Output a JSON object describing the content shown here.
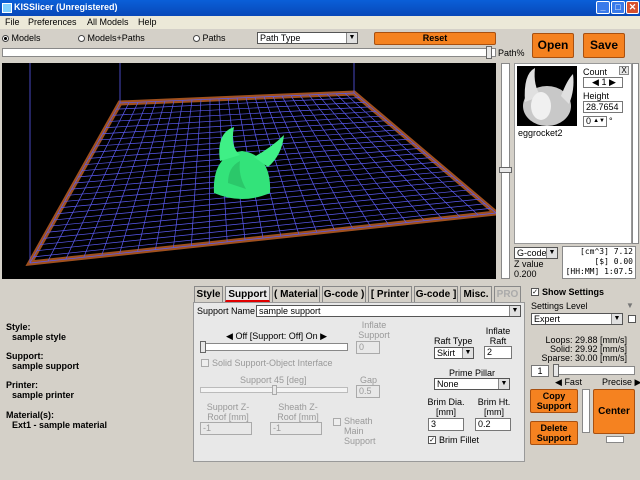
{
  "window": {
    "title": "KISSlicer (Unregistered)"
  },
  "menu": [
    "File",
    "Preferences",
    "All Models",
    "Help"
  ],
  "view_modes": {
    "models": "Models",
    "models_paths": "Models+Paths",
    "paths": "Paths",
    "path_type": "Path Type",
    "reset": "Reset",
    "path_percent": "Path%"
  },
  "actions": {
    "open": "Open",
    "save": "Save"
  },
  "model_panel": {
    "name": "eggrocket2",
    "count_label": "Count",
    "count": "1",
    "height_label": "Height",
    "height": "28.7654",
    "rotation": "0",
    "degree_symbol": "°",
    "close": "X"
  },
  "gcode": {
    "select": "G-code",
    "volume": "[cm^3] 7.12",
    "cost": "[$] 0.00",
    "time": "[HH:MM] 1:07.5",
    "z_label": "Z value",
    "z_value": "0.200"
  },
  "settings": {
    "show_settings": "Show Settings",
    "level_label": "Settings Level",
    "level": "Expert",
    "loops": "Loops: 29.88 [mm/s]",
    "solid": "Solid: 29.92 [mm/s]",
    "sparse": "Sparse: 30.00 [mm/s]",
    "speed_value": "1",
    "fast": "Fast",
    "precise": "Precise",
    "copy_support": "Copy Support",
    "delete_support": "Delete Support",
    "center": "Center"
  },
  "summary": {
    "style_label": "Style:",
    "style": "sample style",
    "support_label": "Support:",
    "support": "sample support",
    "printer_label": "Printer:",
    "printer": "sample printer",
    "material_label": "Material(s):",
    "material": "Ext1 - sample material"
  },
  "tabs": [
    "Style",
    "Support",
    "( Material",
    "G-code )",
    "[ Printer",
    "G-code ]",
    "Misc.",
    "PRO"
  ],
  "support_tab": {
    "name_label": "Support Name",
    "name": "sample support",
    "support_mode": "Off [Support: Off] On",
    "inflate_support": "Inflate Support",
    "inflate_support_value": "0",
    "solid_interface": "Solid Support-Object Interface",
    "angle": "Support 45 [deg]",
    "gap_label": "Gap",
    "gap": "0.5",
    "support_zroof": "Support Z-Roof [mm]",
    "support_zroof_value": "-1",
    "sheath_zroof": "Sheath Z-Roof [mm]",
    "sheath_zroof_value": "-1",
    "sheath_main": "Sheath Main Support",
    "raft_type_label": "Raft Type",
    "raft_type": "Skirt",
    "inflate_raft": "Inflate Raft",
    "inflate_raft_value": "2",
    "prime_pillar_label": "Prime Pillar",
    "prime_pillar": "None",
    "brim_dia": "Brim Dia. [mm]",
    "brim_dia_value": "3",
    "brim_ht": "Brim Ht. [mm]",
    "brim_ht_value": "0.2",
    "brim_fillet": "Brim Fillet"
  },
  "colors": {
    "model": "#33e37a",
    "grid": "#5a5af0",
    "accent": "#f58220"
  }
}
